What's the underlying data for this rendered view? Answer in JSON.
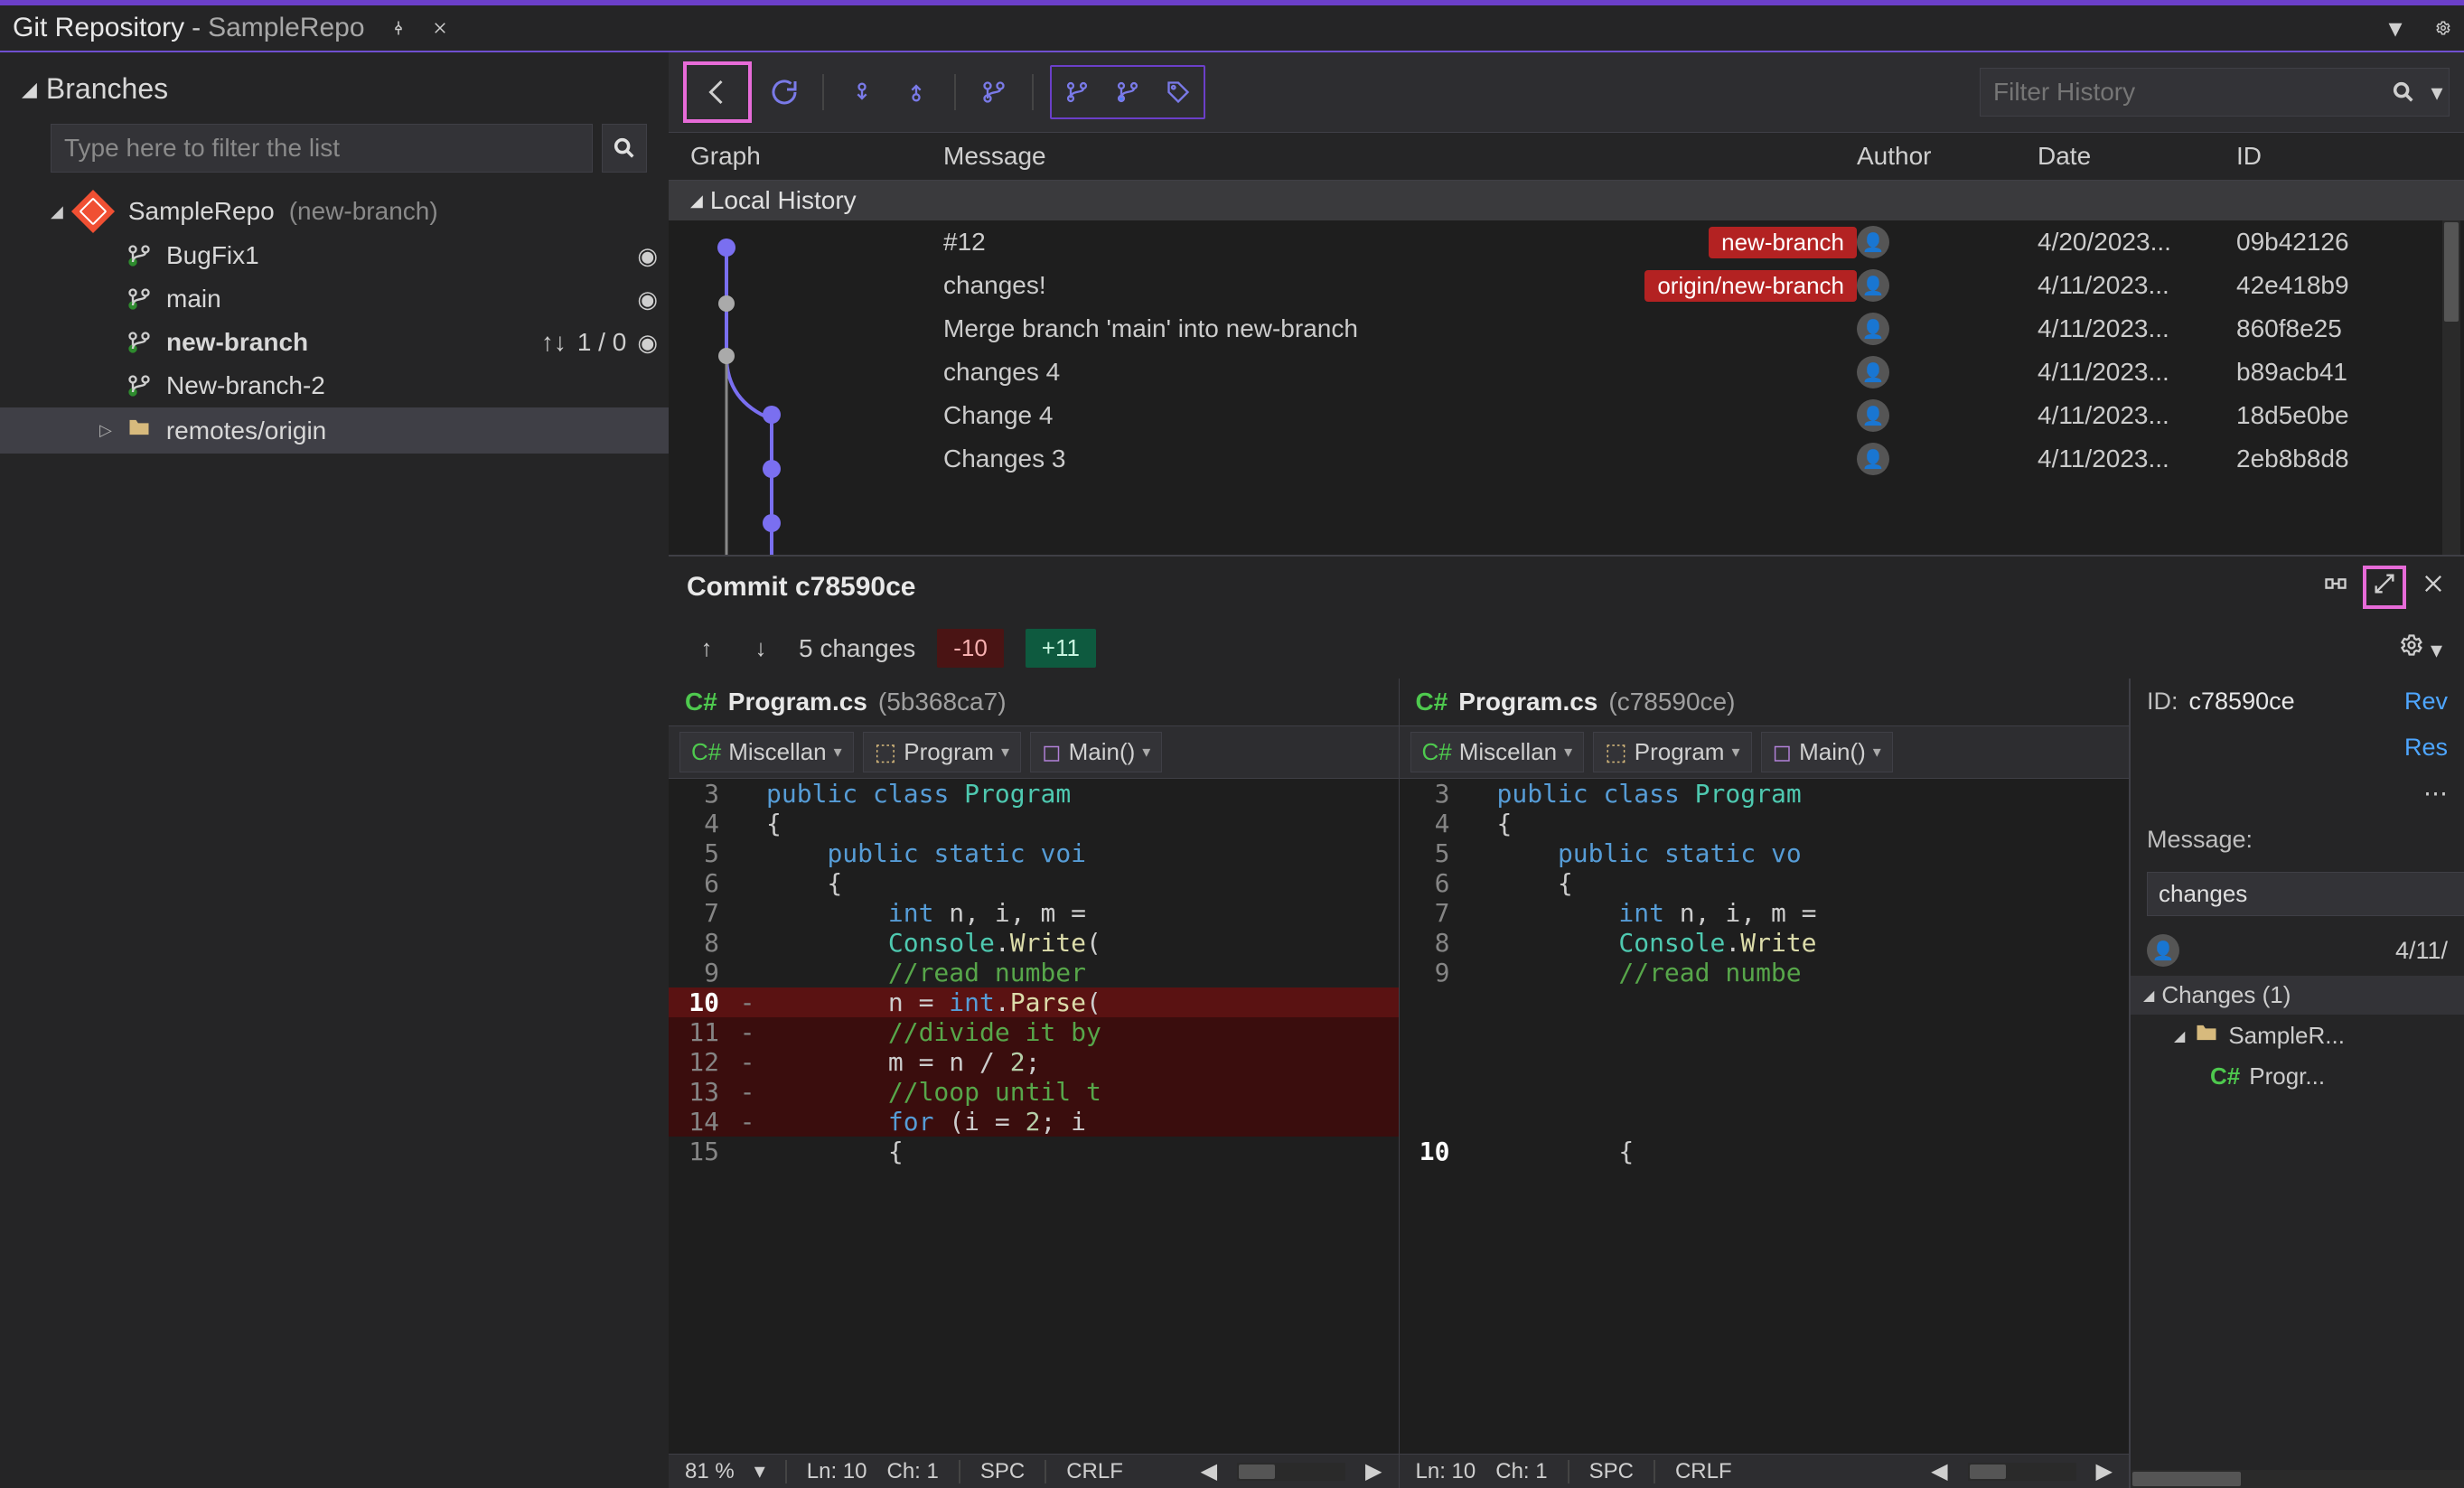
{
  "titlebar": {
    "title": "Git Repository",
    "repo": "SampleRepo"
  },
  "sidebar": {
    "branches_label": "Branches",
    "filter_placeholder": "Type here to filter the list",
    "repo_name": "SampleRepo",
    "repo_current_branch": "(new-branch)",
    "branches": [
      {
        "name": "BugFix1",
        "bold": false,
        "track": ""
      },
      {
        "name": "main",
        "bold": false,
        "track": ""
      },
      {
        "name": "new-branch",
        "bold": true,
        "track": "1 / 0"
      },
      {
        "name": "New-branch-2",
        "bold": false,
        "track": ""
      }
    ],
    "remotes_label": "remotes/origin"
  },
  "history": {
    "filter_placeholder": "Filter History",
    "columns": {
      "graph": "Graph",
      "message": "Message",
      "author": "Author",
      "date": "Date",
      "id": "ID"
    },
    "local_label": "Local History",
    "commits": [
      {
        "message": "#12",
        "tag": "new-branch",
        "date": "4/20/2023...",
        "id": "09b42126"
      },
      {
        "message": "changes!",
        "tag": "origin/new-branch",
        "date": "4/11/2023...",
        "id": "42e418b9"
      },
      {
        "message": "Merge branch 'main' into new-branch",
        "tag": "",
        "date": "4/11/2023...",
        "id": "860f8e25"
      },
      {
        "message": "changes 4",
        "tag": "",
        "date": "4/11/2023...",
        "id": "b89acb41"
      },
      {
        "message": "Change 4",
        "tag": "",
        "date": "4/11/2023...",
        "id": "18d5e0be"
      },
      {
        "message": "Changes 3",
        "tag": "",
        "date": "4/11/2023...",
        "id": "2eb8b8d8"
      }
    ]
  },
  "detail": {
    "title": "Commit c78590ce",
    "changes_label": "5 changes",
    "minus": "-10",
    "plus": "+11",
    "left": {
      "lang": "C#",
      "file": "Program.cs",
      "hash": "(5b368ca7)",
      "nav": {
        "proj": "Miscellan",
        "ns": "Program",
        "fn": "Main()"
      }
    },
    "right": {
      "lang": "C#",
      "file": "Program.cs",
      "hash": "(c78590ce)",
      "nav": {
        "proj": "Miscellan",
        "ns": "Program",
        "fn": "Main()"
      }
    },
    "status_left": {
      "zoom": "81 %",
      "ln": "Ln: 10",
      "ch": "Ch: 1",
      "ws": "SPC",
      "eol": "CRLF"
    },
    "status_right": {
      "ln": "Ln: 10",
      "ch": "Ch: 1",
      "ws": "SPC",
      "eol": "CRLF"
    },
    "side": {
      "id_label": "ID:",
      "id_val": "c78590ce",
      "links": [
        "Rev",
        "Res"
      ],
      "msg_label": "Message:",
      "msg_val": "changes",
      "date": "4/11/",
      "changes_hdr": "Changes (1)",
      "folder": "SampleR...",
      "file_lang": "C#",
      "file_name": "Progr..."
    }
  },
  "code_left": [
    {
      "n": "3",
      "g": "",
      "html": "<span class='kw'>public</span> <span class='kw'>class</span> <span class='cls'>Program</span>"
    },
    {
      "n": "4",
      "g": "",
      "html": "{"
    },
    {
      "n": "5",
      "g": "",
      "html": "    <span class='kw'>public</span> <span class='kw'>static</span> <span class='kw'>voi</span>"
    },
    {
      "n": "6",
      "g": "",
      "html": "    {"
    },
    {
      "n": "7",
      "g": "",
      "html": "        <span class='kw'>int</span> n, i, m = "
    },
    {
      "n": "8",
      "g": "",
      "html": "        <span class='cls'>Console</span>.<span class='mth'>Write</span>("
    },
    {
      "n": "9",
      "g": "",
      "html": "        <span class='cmt'>//read number</span>"
    },
    {
      "n": "10",
      "g": "-",
      "html": "        n = <span class='kw'>int</span>.<span class='mth'>Parse</span>(",
      "cls": "del-hl curr"
    },
    {
      "n": "11",
      "g": "-",
      "html": "        <span class='cmt'>//divide it by</span>",
      "cls": "del-block"
    },
    {
      "n": "12",
      "g": "-",
      "html": "        m = n / <span class='num'>2</span>;",
      "cls": "del-block"
    },
    {
      "n": "13",
      "g": "-",
      "html": "        <span class='cmt'>//loop until t</span>",
      "cls": "del-block"
    },
    {
      "n": "14",
      "g": "-",
      "html": "        <span class='kw'>for</span> (i = <span class='num'>2</span>; i",
      "cls": "del-block"
    },
    {
      "n": "15",
      "g": "",
      "html": "        {"
    }
  ],
  "code_right": [
    {
      "n": "3",
      "g": "",
      "html": "<span class='kw'>public</span> <span class='kw'>class</span> <span class='cls'>Program</span>"
    },
    {
      "n": "4",
      "g": "",
      "html": "{"
    },
    {
      "n": "5",
      "g": "",
      "html": "    <span class='kw'>public</span> <span class='kw'>static</span> <span class='kw'>vo</span>"
    },
    {
      "n": "6",
      "g": "",
      "html": "    {"
    },
    {
      "n": "7",
      "g": "",
      "html": "        <span class='kw'>int</span> n, i, m ="
    },
    {
      "n": "8",
      "g": "",
      "html": "        <span class='cls'>Console</span>.<span class='mth'>Write</span>"
    },
    {
      "n": "9",
      "g": "",
      "html": "        <span class='cmt'>//read numbe</span>"
    },
    {
      "n": "",
      "g": "",
      "html": " ",
      "cls": ""
    },
    {
      "n": "",
      "g": "",
      "html": " ",
      "cls": ""
    },
    {
      "n": "",
      "g": "",
      "html": " ",
      "cls": ""
    },
    {
      "n": "",
      "g": "",
      "html": " ",
      "cls": ""
    },
    {
      "n": "",
      "g": "",
      "html": " ",
      "cls": ""
    },
    {
      "n": "10",
      "g": "",
      "html": "        {",
      "cls": "curr"
    }
  ]
}
